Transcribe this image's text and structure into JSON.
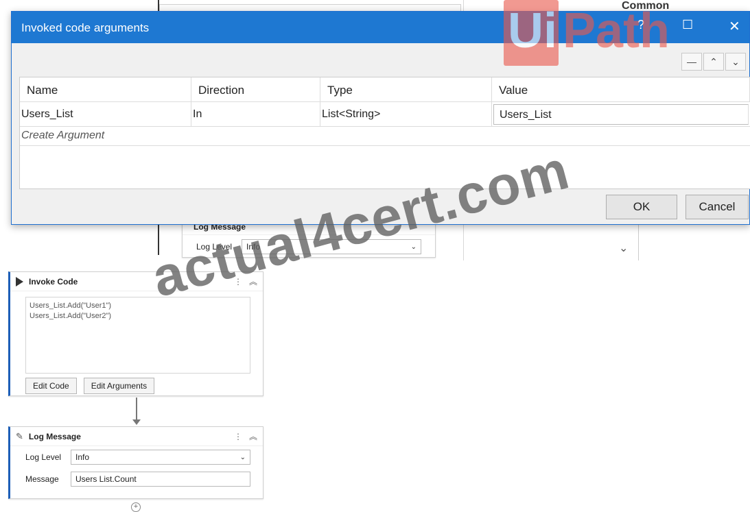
{
  "background": {
    "common_label": "Common",
    "log_message_top": {
      "title": "Log Message",
      "log_level_label": "Log Level",
      "log_level_value": "Info"
    }
  },
  "dialog": {
    "title": "Invoked code arguments",
    "help_label": "?",
    "columns": [
      "Name",
      "Direction",
      "Type",
      "Value"
    ],
    "rows": [
      {
        "name": "Users_List",
        "direction": "In",
        "type": "List<String>",
        "value": "Users_List"
      }
    ],
    "create_argument": "Create Argument",
    "ok_label": "OK",
    "cancel_label": "Cancel"
  },
  "invoke_code": {
    "title": "Invoke Code",
    "code_lines": [
      "Users_List.Add(\"User1\")",
      "Users_List.Add(\"User2\")"
    ],
    "edit_code_label": "Edit Code",
    "edit_arguments_label": "Edit Arguments"
  },
  "log_message": {
    "title": "Log Message",
    "log_level_label": "Log Level",
    "log_level_value": "Info",
    "message_label": "Message",
    "message_value": "Users List.Count"
  },
  "watermarks": {
    "uipath_box": "Ui",
    "uipath_rest": "Path",
    "site": "actual4cert.com"
  },
  "colors": {
    "title_bar": "#1e78d2",
    "uipath_red": "#ea5b4f"
  }
}
